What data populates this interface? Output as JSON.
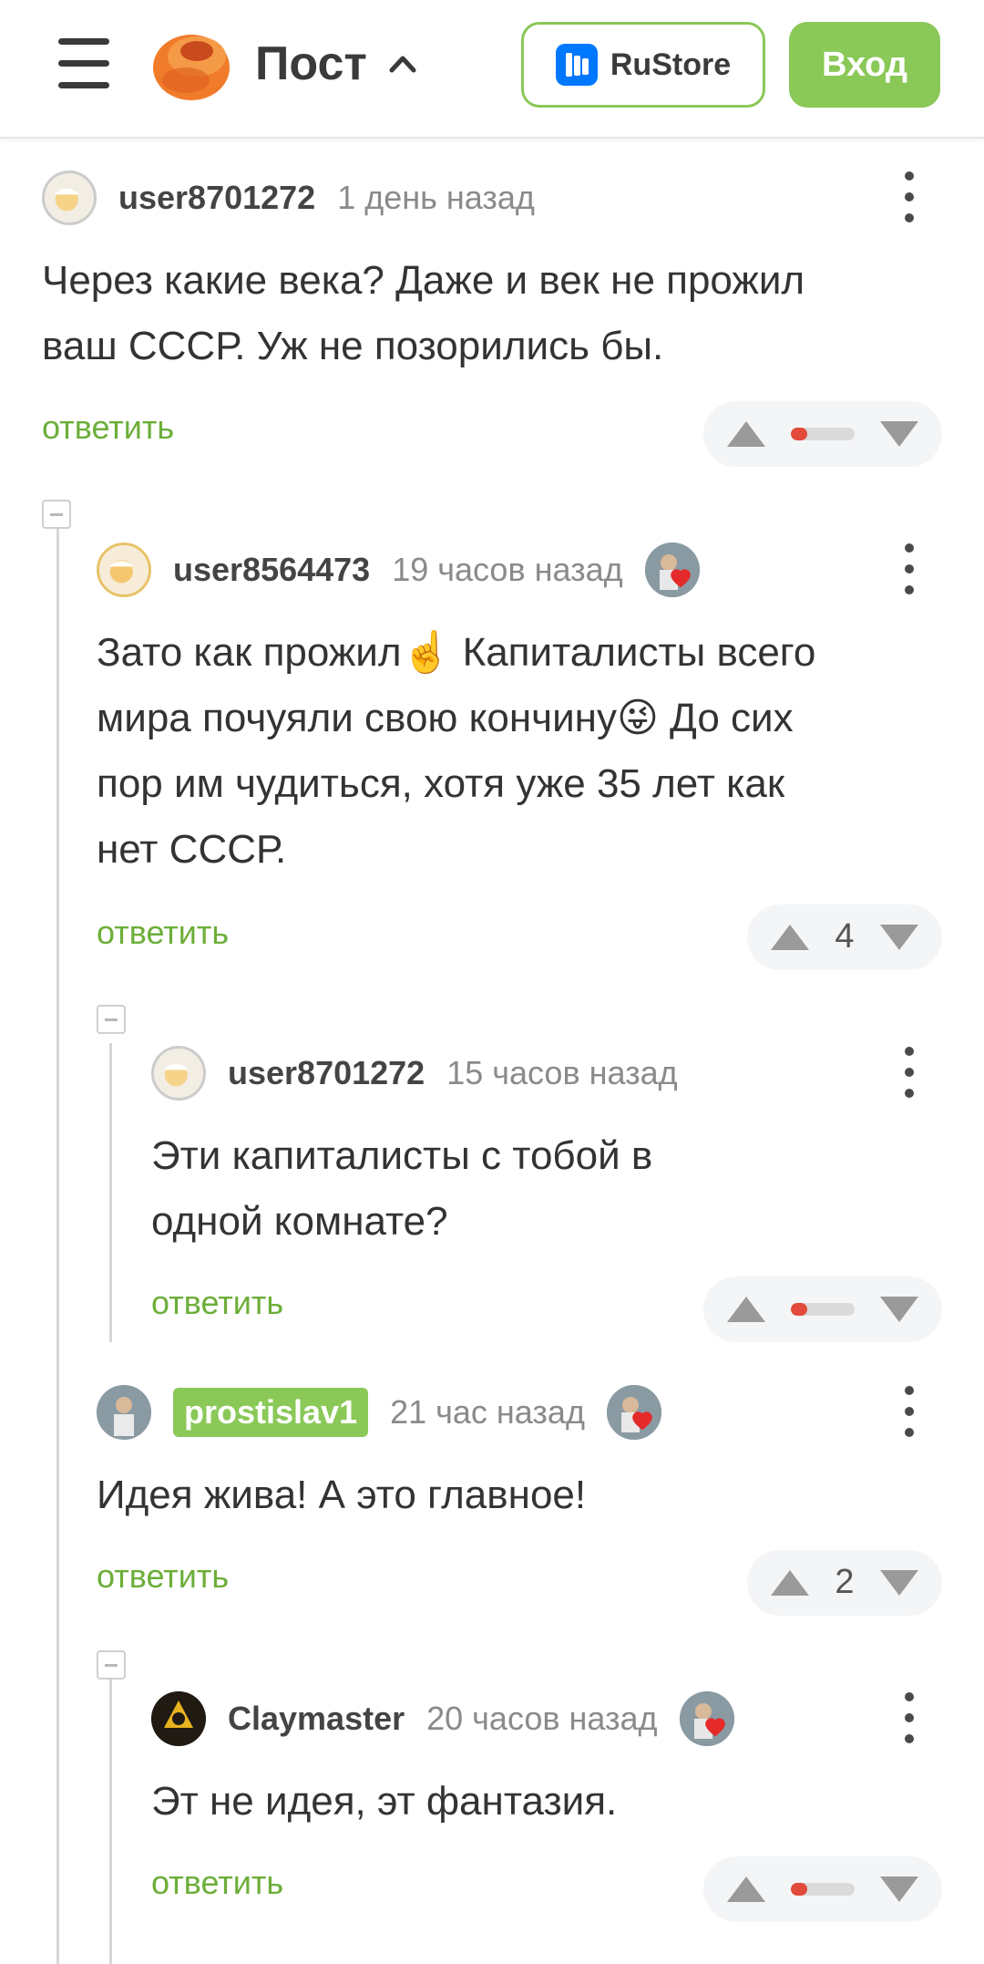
{
  "header": {
    "title": "Пост",
    "rustore_label": "RuStore",
    "login_label": "Вход"
  },
  "colors": {
    "accent": "#8ac858",
    "link": "#6cae39",
    "negative": "#e24a3b"
  },
  "comments": [
    {
      "username": "user8701272",
      "time": "1 день назад",
      "text": [
        "Через какие века? Даже и век не прожил",
        "ваш СССР. Уж не позорились бы."
      ],
      "reply": "ответить",
      "rating_negative_share": 0.25
    },
    {
      "username": "user8564473",
      "time": "19 часов назад",
      "text": [
        "Зато как прожил☝️ Капиталисты всего",
        "мира почуяли свою кончину😜 До сих",
        "пор им чудиться, хотя уже 35 лет как",
        "нет СССР."
      ],
      "reply": "ответить",
      "rating": "4"
    },
    {
      "username": "user8701272",
      "time": "15 часов назад",
      "text": [
        "Эти капиталисты с тобой в",
        "одной комнате?"
      ],
      "reply": "ответить",
      "rating_negative_share": 0.25
    },
    {
      "username": "prostislav1",
      "time": "21 час назад",
      "text": [
        "Идея жива! А это главное!"
      ],
      "reply": "ответить",
      "rating": "2"
    },
    {
      "username": "Claymaster",
      "time": "20 часов назад",
      "text": [
        "Эт не идея, эт фантазия."
      ],
      "reply": "ответить",
      "rating_negative_share": 0.25
    }
  ],
  "icons": {
    "menu": "hamburger-icon",
    "logo": "pikabu-logo",
    "expand": "chevron-up-icon",
    "more": "more-vertical-icon",
    "upvote": "triangle-up-icon",
    "downvote": "triangle-down-icon",
    "collapse": "minus-square-icon"
  }
}
